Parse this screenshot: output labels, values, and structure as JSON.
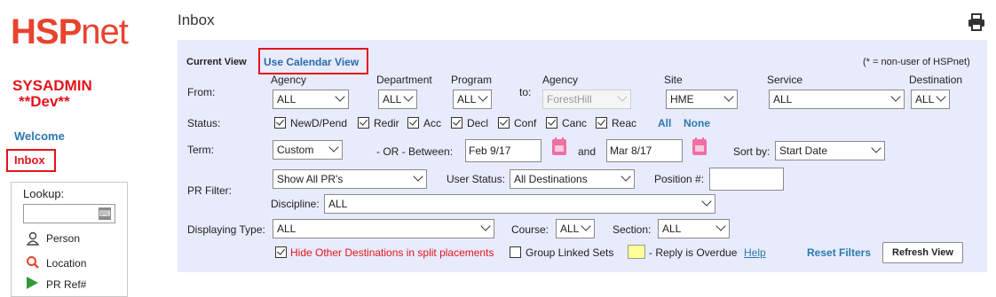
{
  "logo": {
    "hsp": "HSP",
    "net": "net"
  },
  "user": {
    "name": "SYSADMIN",
    "env": "**Dev**"
  },
  "nav": {
    "welcome": "Welcome",
    "inbox": "Inbox"
  },
  "lookup": {
    "title": "Lookup",
    "colon": ":",
    "items": [
      "Person",
      "Location",
      "PR Ref#"
    ]
  },
  "page": {
    "title": "Inbox"
  },
  "panel": {
    "current_view": "Current View",
    "calendar_view": "Use Calendar View",
    "non_user_note": "(* = non-user of HSPnet)",
    "from_label": "From:",
    "agency_label": "Agency",
    "agency_value": "ALL",
    "department_label": "Department",
    "department_value": "ALL",
    "program_label": "Program",
    "program_value": "ALL",
    "to_label": "to:",
    "to_agency_label": "Agency",
    "to_agency_value": "ForestHill",
    "site_label": "Site",
    "site_value": "HME",
    "service_label": "Service",
    "service_value": "ALL",
    "destination_label": "Destination",
    "destination_value": "ALL",
    "status_label": "Status:",
    "statuses": [
      {
        "label": "NewD/Pend",
        "checked": true
      },
      {
        "label": "Redir",
        "checked": true
      },
      {
        "label": "Acc",
        "checked": true
      },
      {
        "label": "Decl",
        "checked": true
      },
      {
        "label": "Conf",
        "checked": true
      },
      {
        "label": "Canc",
        "checked": true
      },
      {
        "label": "Reac",
        "checked": true
      }
    ],
    "all_link": "All",
    "none_link": "None",
    "term_label": "Term:",
    "term_value": "Custom",
    "or_between": "- OR -  Between:",
    "start_date": "Feb 9/17",
    "and_label": "and",
    "end_date": "Mar 8/17",
    "sort_label": "Sort by:",
    "sort_value": "Start Date",
    "pr_filter_label": "PR Filter:",
    "pr_filter_value": "Show All PR's",
    "user_status_label": "User Status:",
    "user_status_value": "All Destinations",
    "position_label": "Position #:",
    "position_value": "",
    "discipline_label": "Discipline:",
    "discipline_value": "ALL",
    "displaying_type_label": "Displaying Type:",
    "displaying_type_value": "ALL",
    "course_label": "Course:",
    "course_value": "ALL",
    "section_label": "Section:",
    "section_value": "ALL",
    "hide_other_label": "Hide Other Destinations in split placements",
    "group_linked_label": "Group Linked Sets",
    "overdue_label": "- Reply is Overdue",
    "help_link": "Help",
    "reset_filters": "Reset Filters",
    "refresh_view": "Refresh View"
  },
  "colors": {
    "brand": "#e8432e",
    "panel_bg": "#e8ebfc",
    "link": "#2a7ab0",
    "highlight": "#e3141b",
    "overdue": "#ffff99"
  }
}
